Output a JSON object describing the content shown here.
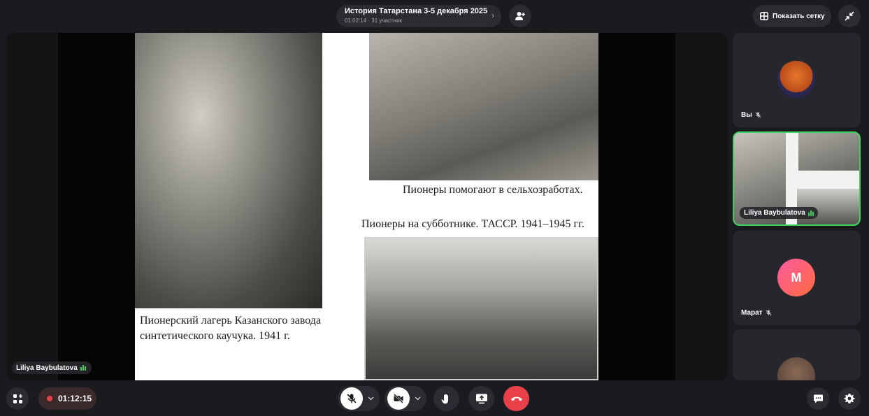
{
  "meeting": {
    "title": "История Татарстана 3-5 декабря 2025",
    "subtitle": "01:02:14 · 31 участник",
    "grid_label": "Показать сетку"
  },
  "stage": {
    "speaker_name": "Liliya Baybulatova",
    "slide": {
      "caption_left": "Пионерский лагерь Казанского завода синтетического каучука. 1941 г.",
      "caption_top_right": "Пионеры помогают в сельхозработах.",
      "caption_mid_right": "Пионеры на субботнике. ТАССР. 1941–1945 гг."
    }
  },
  "tiles": [
    {
      "name": "Вы",
      "avatar": "fox-avatar",
      "muted": true
    },
    {
      "name": "Liliya Baybulatova",
      "active": true,
      "speaking": true
    },
    {
      "name": "Марат",
      "initial": "М",
      "muted": true
    },
    {
      "name": "",
      "avatar": "photo-avatar"
    }
  ],
  "toolbar": {
    "recording_time": "01:12:15"
  },
  "colors": {
    "background": "#1a1b1f",
    "button": "#2b2c31",
    "end_call": "#e8414a",
    "speaking": "#3fd15f"
  }
}
